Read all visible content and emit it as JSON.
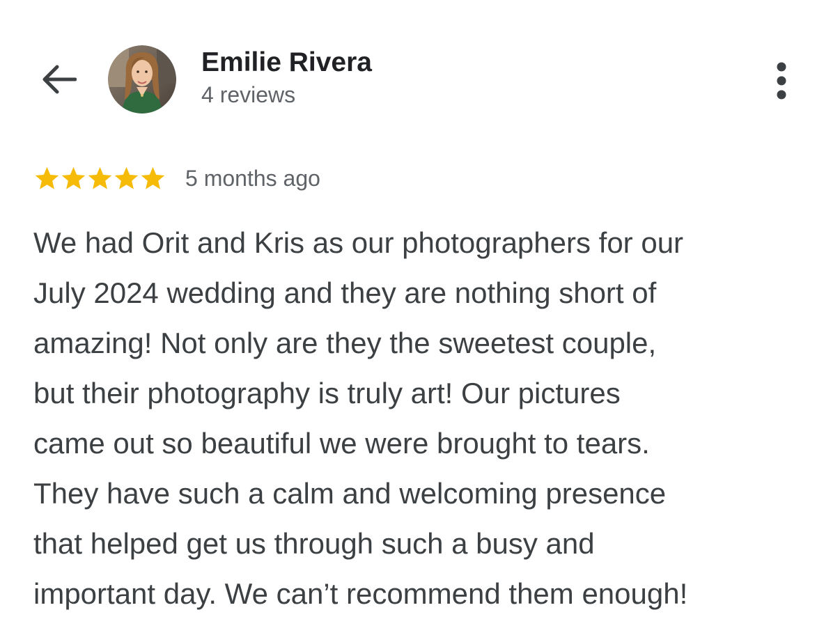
{
  "header": {
    "back_icon": "arrow-back-icon",
    "more_icon": "more-vert-icon",
    "reviewer": {
      "name": "Emilie Rivera",
      "review_count": "4 reviews",
      "avatar": "profile-photo"
    }
  },
  "review": {
    "rating": 5,
    "rating_max": 5,
    "star_color": "#f6bb06",
    "date": "5 months ago",
    "lines": [
      "We had Orit and Kris as our photographers for our",
      "July 2024 wedding and they are nothing short of",
      "amazing! Not only are they the sweetest couple,",
      "but their photography is truly art! Our pictures",
      "came out so beautiful we were brought to tears.",
      "They have such a calm and welcoming presence",
      "that helped get us through such a busy and",
      "important day. We can’t recommend them enough!"
    ]
  }
}
